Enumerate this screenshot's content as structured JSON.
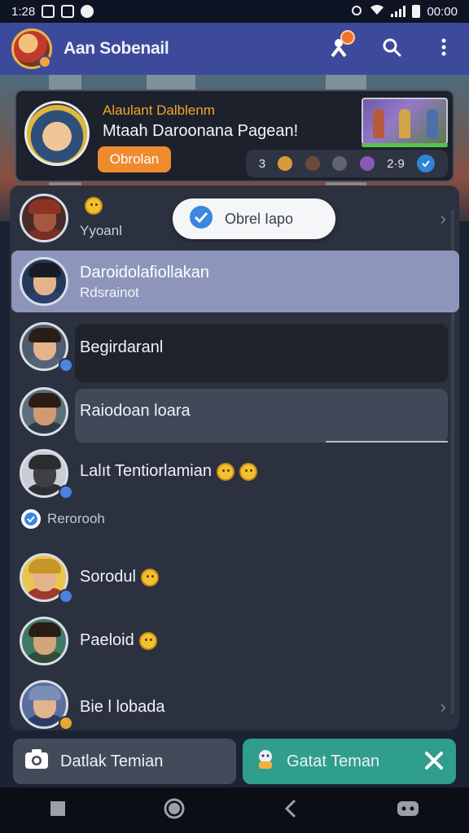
{
  "status_bar": {
    "time": "1:28",
    "clock": "00:00"
  },
  "app_bar": {
    "title": "Aan Sobenail"
  },
  "promo": {
    "kicker": "Alaulant Dalblenm",
    "title": "Mtaah Daroonana Pagean!",
    "button_label": "Obrolan",
    "reaction_count_1": "3",
    "reaction_count_2": "2",
    "reaction_count_3": "9"
  },
  "toast": {
    "label": "Obrel  Iapo"
  },
  "list": {
    "rows": [
      {
        "sub": "Yyoanl"
      },
      {
        "name": "Daroidolafiollakan",
        "sub": "Rdsrainot"
      },
      {
        "name": "Begirdaranl"
      },
      {
        "name": "Raiodoan loara"
      },
      {
        "name": "Lalıt Tentiorlamian"
      },
      {
        "name": "Sorodul"
      },
      {
        "name": "Paeloid"
      },
      {
        "name": "Bie l lobada"
      }
    ],
    "section_label": "Rerorooh"
  },
  "actions": {
    "find_label": "Datlak Temian",
    "add_label": "Gatat Teman"
  },
  "colors": {
    "app_bar": "#3d4a9c",
    "accent_orange": "#ef8b2f",
    "accent_teal": "#2f9e8c",
    "selected_row": "#8d96ba",
    "verified_blue": "#2f84d8"
  }
}
